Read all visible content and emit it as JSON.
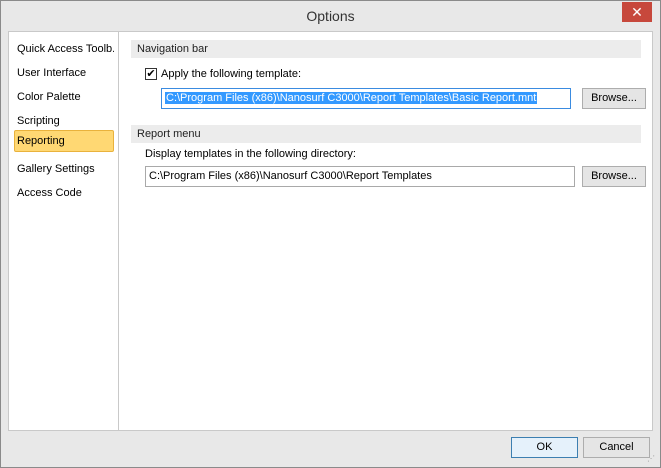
{
  "window": {
    "title": "Options",
    "close_glyph": "✕"
  },
  "sidebar": {
    "items": [
      {
        "label": "Quick Access Toolb..."
      },
      {
        "label": "User Interface"
      },
      {
        "label": "Color Palette"
      },
      {
        "label": "Scripting"
      },
      {
        "label": "Reporting",
        "selected": true
      },
      {
        "label": "Gallery Settings"
      },
      {
        "label": "Access Code"
      }
    ]
  },
  "navigation_bar": {
    "header": "Navigation bar",
    "apply_template_label": "Apply the following template:",
    "apply_template_checked": true,
    "check_glyph": "✔",
    "template_path": "C:\\Program Files (x86)\\Nanosurf C3000\\Report Templates\\Basic Report.mnt",
    "browse_label": "Browse..."
  },
  "report_menu": {
    "header": "Report menu",
    "directory_label": "Display templates in the following directory:",
    "directory_path": "C:\\Program Files (x86)\\Nanosurf C3000\\Report Templates",
    "browse_label": "Browse..."
  },
  "footer": {
    "ok_label": "OK",
    "cancel_label": "Cancel"
  },
  "colors": {
    "selected_item_bg": "#ffd873",
    "close_button_bg": "#c7483c",
    "selection_highlight": "#3399ff"
  }
}
